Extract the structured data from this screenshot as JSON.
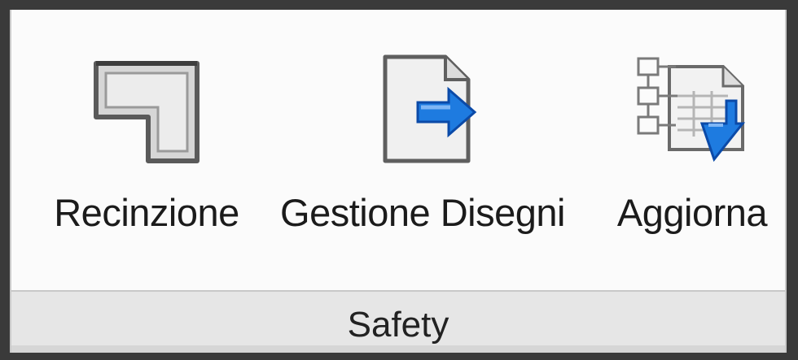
{
  "panel": {
    "title": "Safety",
    "buttons": [
      {
        "label": "Recinzione",
        "icon": "fence-icon"
      },
      {
        "label": "Gestione Disegni",
        "icon": "document-export-icon"
      },
      {
        "label": "Aggiorna",
        "icon": "update-table-download-icon"
      }
    ]
  },
  "colors": {
    "panel_bg": "#fbfbfb",
    "footer_bg": "#e6e6e6",
    "accent_blue": "#1e7be0",
    "icon_gray": "#6b6b6b"
  }
}
